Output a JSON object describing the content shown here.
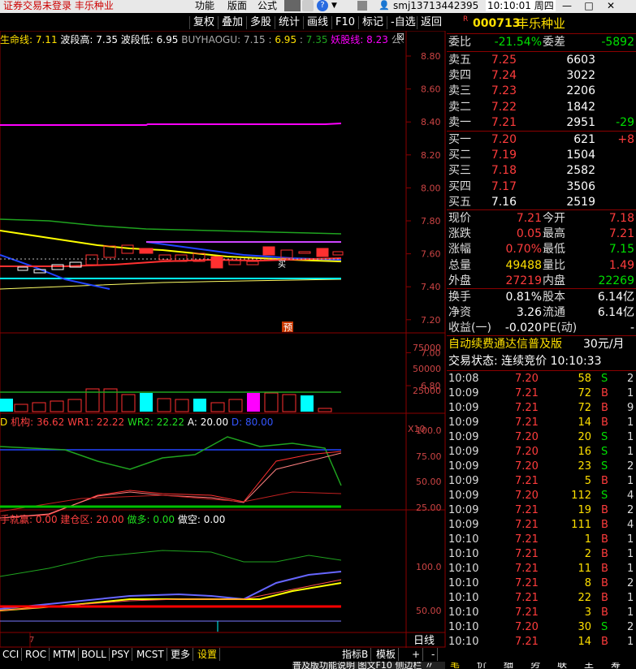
{
  "titlebar": {
    "left_text": "证券交易未登录  丰乐种业",
    "menu": [
      "功能",
      "版面",
      "公式"
    ],
    "user": "smj13713442395",
    "time": "10:10:01 周四"
  },
  "toolbar": [
    "复权",
    "叠加",
    "多股",
    "统计",
    "画线",
    "F10",
    "标记",
    "-自选",
    "返回"
  ],
  "main_chart": {
    "indicator_line": {
      "name1": "生命线: ",
      "val1": "7.11",
      "name2": " 波段高: ",
      "val2": "7.35",
      "name3": " 波段低: ",
      "val3": "6.95",
      "name4": " BUYHAOGU: ",
      "val4": "7.15",
      "sep1": " : ",
      "val5": "6.95",
      "sep2": " : ",
      "val6": "7.35",
      "name5": "  妖股线: ",
      "val7": "8.23",
      "tail": " 公◇"
    },
    "y_ticks": [
      "8.80",
      "8.60",
      "8.40",
      "8.20",
      "8.00",
      "7.80",
      "7.60",
      "7.40",
      "7.20",
      "7.00",
      "6.80"
    ],
    "marker": "预",
    "mark_label": "买"
  },
  "volume_chart": {
    "y_ticks": [
      "75000",
      "50000",
      "25000"
    ],
    "x_label": "X10"
  },
  "wr_chart": {
    "prefix": "D",
    "name1": " 机构: ",
    "val1": "36.62",
    "name2": " WR1: ",
    "val2": "22.22",
    "name3": " WR2: ",
    "val3": "22.22",
    "name4": " A: ",
    "val4": "20.00",
    "name5": " D: ",
    "val5": "80.00",
    "y_ticks": [
      "100.0",
      "75.00",
      "50.00",
      "25.00"
    ]
  },
  "cost_chart": {
    "name1": "手就赢: ",
    "val1": "0.00",
    "name2": " 建仓区: ",
    "val2": "20.00",
    "name3": " 做多: ",
    "val3": "0.00",
    "name4": " 做空: ",
    "val4": "0.00",
    "y_ticks": [
      "100.0",
      "50.00"
    ]
  },
  "x_axis": {
    "label": "7",
    "period": "日线"
  },
  "bottom_tabs": [
    "CCI",
    "ROC",
    "MTM",
    "BOLL",
    "PSY",
    "MCST",
    "更多",
    "设置"
  ],
  "bottom_right": [
    "指标B",
    "模板",
    "+",
    "-"
  ],
  "stock": {
    "flag": "R",
    "code": "000713",
    "name": "丰乐种业"
  },
  "quote": {
    "weibi_label": "委比",
    "weibi": "-21.54%",
    "weicha_label": "委差",
    "weicha": "-5892",
    "asks": [
      {
        "label": "卖五",
        "price": "7.25",
        "vol": "6603",
        "chg": ""
      },
      {
        "label": "卖四",
        "price": "7.24",
        "vol": "3022",
        "chg": ""
      },
      {
        "label": "卖三",
        "price": "7.23",
        "vol": "2206",
        "chg": ""
      },
      {
        "label": "卖二",
        "price": "7.22",
        "vol": "1842",
        "chg": ""
      },
      {
        "label": "卖一",
        "price": "7.21",
        "vol": "2951",
        "chg": "-29"
      }
    ],
    "bids": [
      {
        "label": "买一",
        "price": "7.20",
        "vol": "621",
        "chg": "+8"
      },
      {
        "label": "买二",
        "price": "7.19",
        "vol": "1504",
        "chg": ""
      },
      {
        "label": "买三",
        "price": "7.18",
        "vol": "2582",
        "chg": ""
      },
      {
        "label": "买四",
        "price": "7.17",
        "vol": "3506",
        "chg": ""
      },
      {
        "label": "买五",
        "price": "7.16",
        "vol": "2519",
        "chg": ""
      }
    ],
    "stats": [
      {
        "l1": "现价",
        "v1": "7.21",
        "l2": "今开",
        "v2": "7.18"
      },
      {
        "l1": "涨跌",
        "v1": "0.05",
        "l2": "最高",
        "v2": "7.21"
      },
      {
        "l1": "涨幅",
        "v1": "0.70%",
        "l2": "最低",
        "v2": "7.15"
      },
      {
        "l1": "总量",
        "v1": "49488",
        "l2": "量比",
        "v2": "1.49"
      },
      {
        "l1": "外盘",
        "v1": "27219",
        "l2": "内盘",
        "v2": "22269"
      }
    ],
    "fund": [
      {
        "l1": "换手",
        "v1": "0.81%",
        "l2": "股本",
        "v2": "6.14亿"
      },
      {
        "l1": "净资",
        "v1": "3.26",
        "l2": "流通",
        "v2": "6.14亿"
      },
      {
        "l1": "收益(一)",
        "v1": "-0.020",
        "l2": "PE(动)",
        "v2": "-"
      }
    ],
    "ad_text": "自动续费通达信普及版",
    "ad_price": "30元/月",
    "status": "交易状态: 连续竞价 10:10:33"
  },
  "trades": [
    {
      "t": "10:08",
      "p": "7.20",
      "v": "58",
      "bs": "S",
      "n": "2"
    },
    {
      "t": "10:09",
      "p": "7.21",
      "v": "72",
      "bs": "B",
      "n": "1"
    },
    {
      "t": "10:09",
      "p": "7.21",
      "v": "72",
      "bs": "B",
      "n": "9"
    },
    {
      "t": "10:09",
      "p": "7.21",
      "v": "14",
      "bs": "B",
      "n": "1"
    },
    {
      "t": "10:09",
      "p": "7.20",
      "v": "20",
      "bs": "S",
      "n": "1"
    },
    {
      "t": "10:09",
      "p": "7.20",
      "v": "16",
      "bs": "S",
      "n": "1"
    },
    {
      "t": "10:09",
      "p": "7.20",
      "v": "23",
      "bs": "S",
      "n": "2"
    },
    {
      "t": "10:09",
      "p": "7.21",
      "v": "5",
      "bs": "B",
      "n": "1"
    },
    {
      "t": "10:09",
      "p": "7.20",
      "v": "112",
      "bs": "S",
      "n": "4"
    },
    {
      "t": "10:09",
      "p": "7.21",
      "v": "19",
      "bs": "B",
      "n": "2"
    },
    {
      "t": "10:09",
      "p": "7.21",
      "v": "111",
      "bs": "B",
      "n": "4"
    },
    {
      "t": "10:10",
      "p": "7.21",
      "v": "1",
      "bs": "B",
      "n": "1"
    },
    {
      "t": "10:10",
      "p": "7.21",
      "v": "2",
      "bs": "B",
      "n": "1"
    },
    {
      "t": "10:10",
      "p": "7.21",
      "v": "11",
      "bs": "B",
      "n": "1"
    },
    {
      "t": "10:10",
      "p": "7.21",
      "v": "8",
      "bs": "B",
      "n": "2"
    },
    {
      "t": "10:10",
      "p": "7.21",
      "v": "22",
      "bs": "B",
      "n": "1"
    },
    {
      "t": "10:10",
      "p": "7.21",
      "v": "3",
      "bs": "B",
      "n": "1"
    },
    {
      "t": "10:10",
      "p": "7.20",
      "v": "30",
      "bs": "S",
      "n": "2"
    },
    {
      "t": "10:10",
      "p": "7.21",
      "v": "14",
      "bs": "B",
      "n": "1"
    }
  ],
  "right_tabs": [
    "笔",
    "价",
    "细",
    "势",
    "联",
    "主",
    "筹"
  ],
  "footer_ticker": "普及版功能说明 图文F10 侧边栏 〃",
  "colors": {
    "up": "#ff3c3c",
    "down": "#00e000",
    "panel_border": "#8b0000",
    "magenta": "#ff00ff",
    "cyan": "#00ffff",
    "yellow": "#ffff00"
  }
}
